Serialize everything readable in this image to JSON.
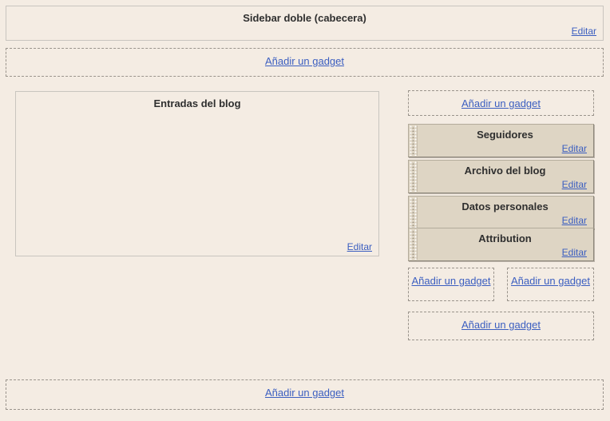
{
  "colors": {
    "page_background": "#f4ece3",
    "gadget_background": "#ded5c4",
    "link_blue": "#3b5ec0",
    "solid_border": "#c9c5bf",
    "dashed_border": "#9a948c",
    "title_text": "#2f2f2f"
  },
  "labels": {
    "edit": "Editar",
    "add_gadget": "Añadir un gadget"
  },
  "header": {
    "title": "Sidebar doble (cabecera)",
    "edit_label": "Editar"
  },
  "header_add_gadget": {
    "label": "Añadir un gadget"
  },
  "main": {
    "blog_posts": {
      "title": "Entradas del blog",
      "edit_label": "Editar"
    }
  },
  "sidebar": {
    "add_top": {
      "label": "Añadir un gadget"
    },
    "gadgets": [
      {
        "title": "Seguidores",
        "edit_label": "Editar"
      },
      {
        "title": "Archivo del blog",
        "edit_label": "Editar"
      },
      {
        "title": "Datos personales",
        "edit_label": "Editar"
      },
      {
        "title": "Attribution",
        "edit_label": "Editar"
      }
    ],
    "add_left": {
      "label": "Añadir un gadget"
    },
    "add_right": {
      "label": "Añadir un gadget"
    },
    "add_bottom": {
      "label": "Añadir un gadget"
    }
  },
  "footer": {
    "add_gadget": {
      "label": "Añadir un gadget"
    }
  }
}
